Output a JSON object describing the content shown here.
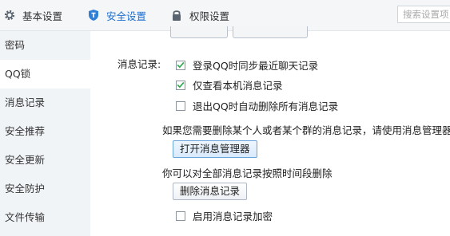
{
  "tabs": {
    "basic": {
      "label": "基本设置",
      "icon": "gear-icon"
    },
    "security": {
      "label": "安全设置",
      "icon": "shield-icon",
      "active": true
    },
    "permission": {
      "label": "权限设置",
      "icon": "lock-icon"
    }
  },
  "search": {
    "placeholder": "搜索设置项"
  },
  "sidebar": {
    "items": [
      {
        "label": "密码"
      },
      {
        "label": "QQ锁",
        "active": true
      },
      {
        "label": "消息记录"
      },
      {
        "label": "安全推荐"
      },
      {
        "label": "安全更新"
      },
      {
        "label": "安全防护"
      },
      {
        "label": "文件传输"
      }
    ]
  },
  "message_record": {
    "section_label": "消息记录:",
    "options": [
      {
        "label": "登录QQ时同步最近聊天记录",
        "checked": true
      },
      {
        "label": "仅查看本机消息记录",
        "checked": true
      },
      {
        "label": "退出QQ时自动删除所有消息记录",
        "checked": false
      }
    ],
    "delete_hint": "如果您需要删除某个人或者某个群的消息记录，请使用消息管理器",
    "open_manager_button": "打开消息管理器",
    "time_delete_hint": "你可以对全部消息记录按照时间段删除",
    "delete_button": "删除消息记录",
    "encrypt_option": {
      "label": "启用消息记录加密",
      "checked": false
    }
  },
  "colors": {
    "accent": "#1e6fcf",
    "check": "#2fa84f",
    "sidebar_bg": "#f1f4f7"
  }
}
